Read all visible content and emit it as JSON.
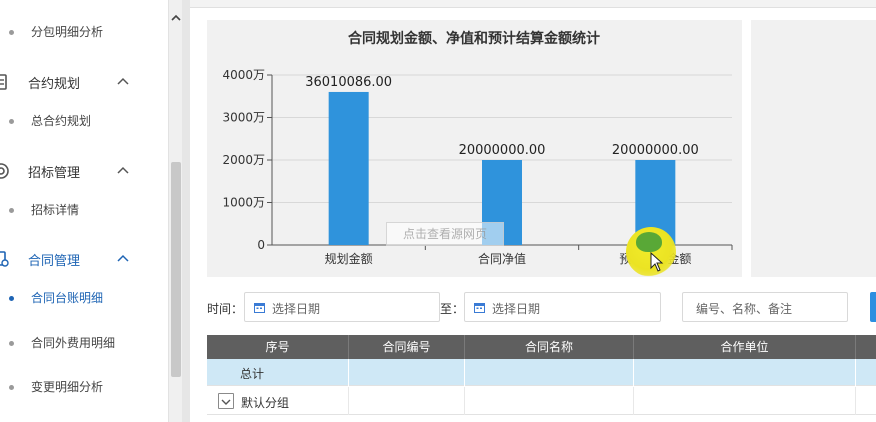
{
  "sidebar": {
    "items": [
      {
        "type": "sub",
        "label": "分包明细分析",
        "active": false
      },
      {
        "type": "group",
        "label": "合约规划",
        "icon": "document-icon",
        "expanded": true,
        "active": false
      },
      {
        "type": "sub",
        "label": "总合约规划",
        "active": false
      },
      {
        "type": "group",
        "label": "招标管理",
        "icon": "target-icon",
        "expanded": true,
        "active": false
      },
      {
        "type": "sub",
        "label": "招标详情",
        "active": false
      },
      {
        "type": "group",
        "label": "合同管理",
        "icon": "contract-icon",
        "expanded": true,
        "active": true
      },
      {
        "type": "sub",
        "label": "合同台账明细",
        "active": true
      },
      {
        "type": "sub",
        "label": "合同外费用明细",
        "active": false
      },
      {
        "type": "sub",
        "label": "变更明细分析",
        "active": false
      }
    ]
  },
  "chart_data": {
    "type": "bar",
    "title": "合同规划金额、净值和预计结算金额统计",
    "categories": [
      "规划金额",
      "合同净值",
      "预计结算金额"
    ],
    "values": [
      36010086.0,
      20000000.0,
      20000000.0
    ],
    "data_labels": [
      "36010086.00",
      "20000000.00",
      "20000000.00"
    ],
    "y_ticks": [
      0,
      10000000,
      20000000,
      30000000,
      40000000
    ],
    "y_tick_labels": [
      "0",
      "1000万",
      "2000万",
      "3000万",
      "4000万"
    ],
    "ylim": [
      0,
      40000000
    ],
    "grid": true,
    "bar_color": "#2f93dc",
    "xlabel": "",
    "ylabel": ""
  },
  "filters": {
    "time_label": "时间：",
    "start_placeholder": "选择日期",
    "to_label": "至：",
    "end_placeholder": "选择日期",
    "search_placeholder": "编号、名称、备注"
  },
  "table": {
    "columns": [
      "序号",
      "合同编号",
      "合同名称",
      "合作单位"
    ],
    "total_label": "总计",
    "group_label": "默认分组"
  },
  "watermark": "点击查看源网页",
  "colors": {
    "accent": "#1e64b4",
    "header_bg": "#5f5f5f",
    "total_row_bg": "#cfe8f6",
    "bar": "#2f93dc"
  }
}
